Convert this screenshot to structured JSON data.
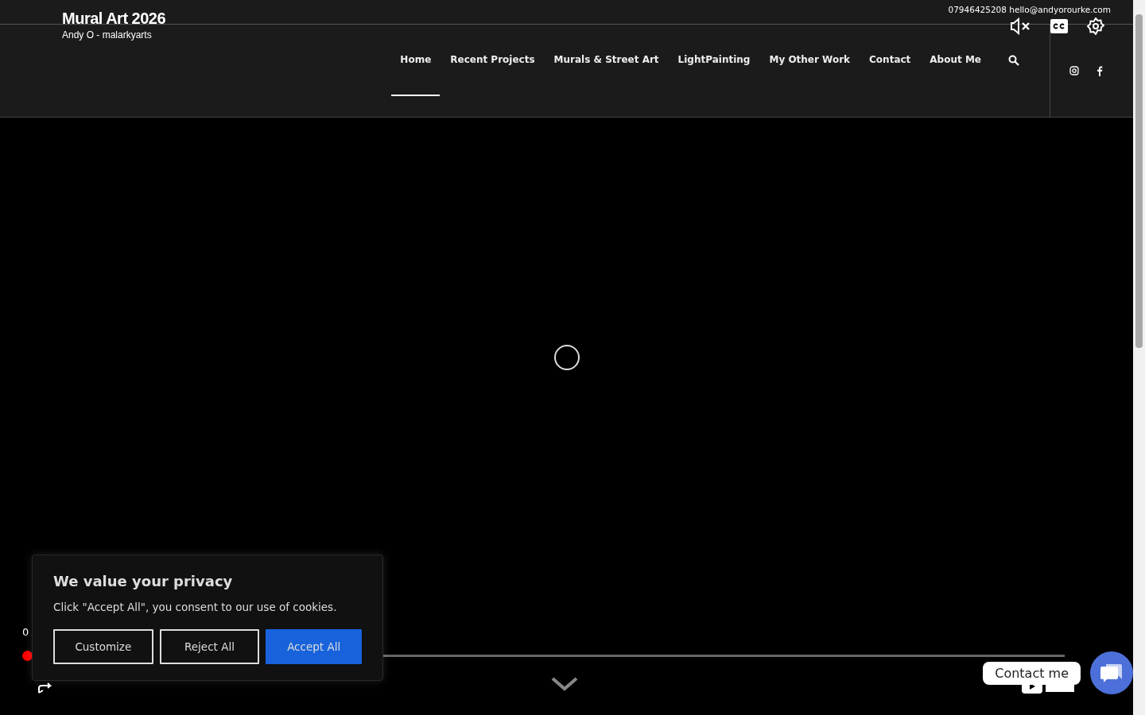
{
  "site": {
    "title": "Mural Art 2026",
    "tagline": "Andy O - malarkyarts",
    "contact_info": "07946425208 hello@andyorourke.com"
  },
  "nav": [
    {
      "label": "Home",
      "selected": true
    },
    {
      "label": "Recent Projects",
      "selected": false
    },
    {
      "label": "Murals & Street Art",
      "selected": false
    },
    {
      "label": "LightPainting",
      "selected": false
    },
    {
      "label": "My Other Work",
      "selected": false
    },
    {
      "label": "Contact",
      "selected": false
    },
    {
      "label": "About Me",
      "selected": false
    }
  ],
  "video": {
    "time": "0",
    "progress": {
      "level": 0.0
    }
  },
  "cookie_banner": {
    "title": "We value your privacy",
    "text": "Click \"Accept All\", you consent to our use of cookies.",
    "buttons": [
      {
        "label": "Customize",
        "kind": "outline"
      },
      {
        "label": "Reject All",
        "kind": "outline"
      },
      {
        "label": "Accept All",
        "kind": "primary"
      }
    ]
  },
  "chat": {
    "label": "Contact me"
  }
}
